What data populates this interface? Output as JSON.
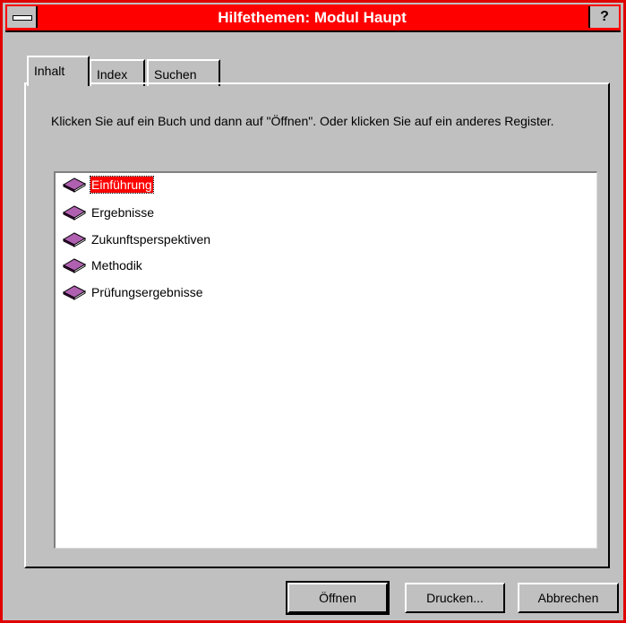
{
  "window": {
    "title": "Hilfethemen: Modul Haupt",
    "help_glyph": "?"
  },
  "tabs": [
    {
      "label": "Inhalt",
      "active": true
    },
    {
      "label": "Index",
      "active": false
    },
    {
      "label": "Suchen",
      "active": false
    }
  ],
  "instruction": "Klicken Sie auf ein Buch und dann auf \"Öffnen\". Oder klicken Sie auf ein anderes Register.",
  "books": [
    {
      "label": "Einführung",
      "selected": true
    },
    {
      "label": "Ergebnisse",
      "selected": false
    },
    {
      "label": "Zukunftsperspektiven",
      "selected": false
    },
    {
      "label": "Methodik",
      "selected": false
    },
    {
      "label": "Prüfungsergebnisse",
      "selected": false
    }
  ],
  "buttons": {
    "open": "Öffnen",
    "print": "Drucken...",
    "cancel": "Abbrechen"
  },
  "colors": {
    "titlebar": "#ff0000",
    "selection": "#ff0000",
    "book": "#800080",
    "face": "#c0c0c0"
  },
  "icons": {
    "book": "book-icon",
    "system_menu": "system-menu-icon",
    "help": "help-icon"
  }
}
